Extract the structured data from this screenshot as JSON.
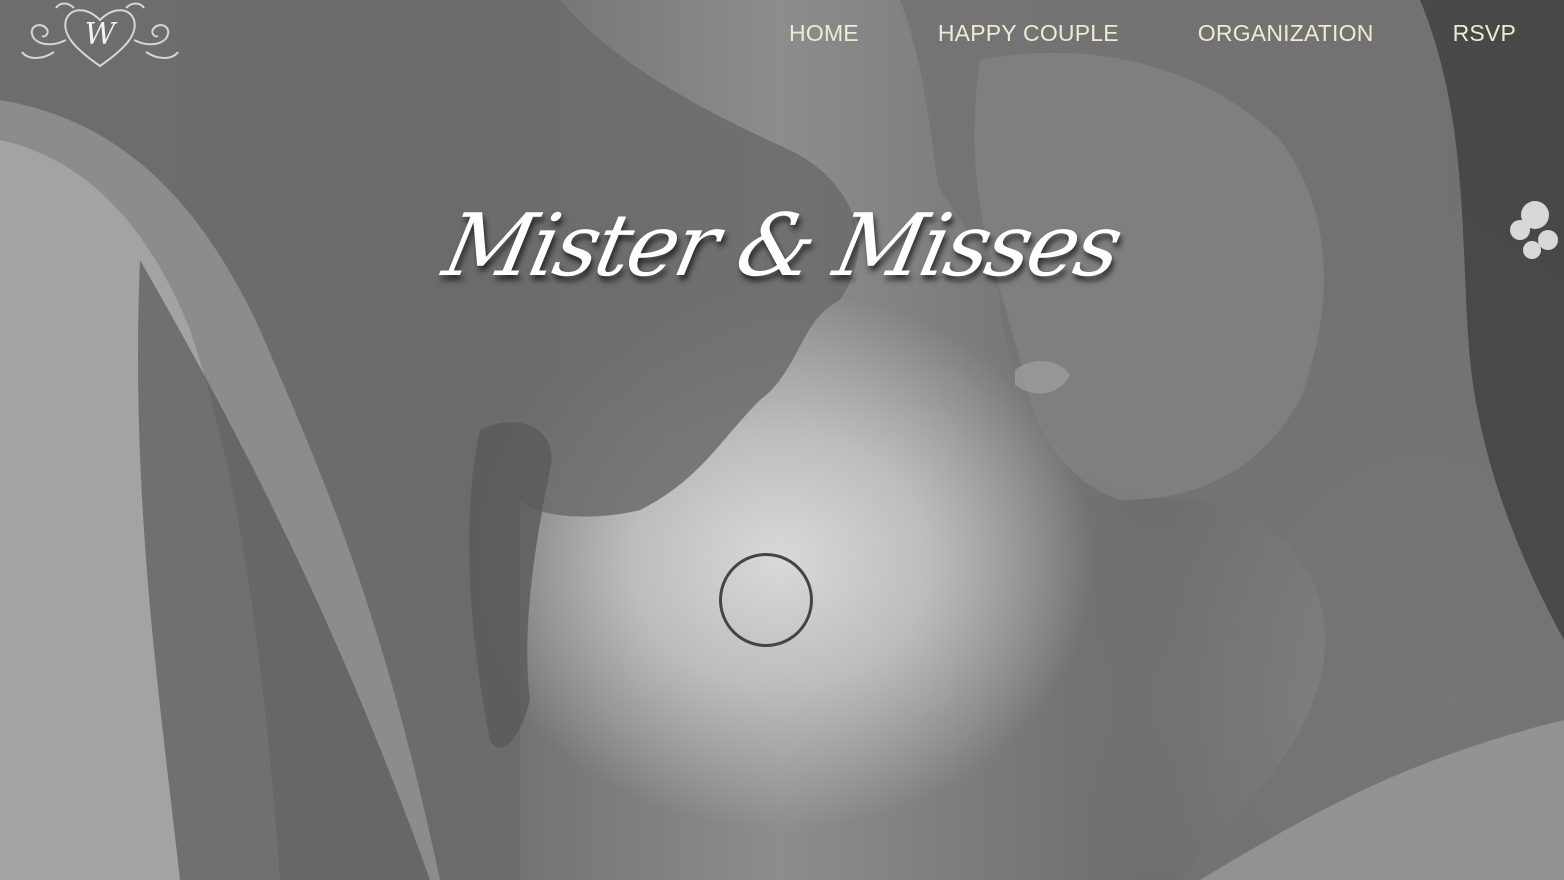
{
  "logo": {
    "icon": "heart-monogram-logo",
    "letter": "W"
  },
  "nav": {
    "items": [
      {
        "label": "HOME"
      },
      {
        "label": "HAPPY COUPLE"
      },
      {
        "label": "ORGANIZATION"
      },
      {
        "label": "RSVP"
      }
    ],
    "color": "#f1ead0"
  },
  "hero": {
    "title": "Mister & Misses",
    "scroll_icon": "circle-outline-icon"
  }
}
